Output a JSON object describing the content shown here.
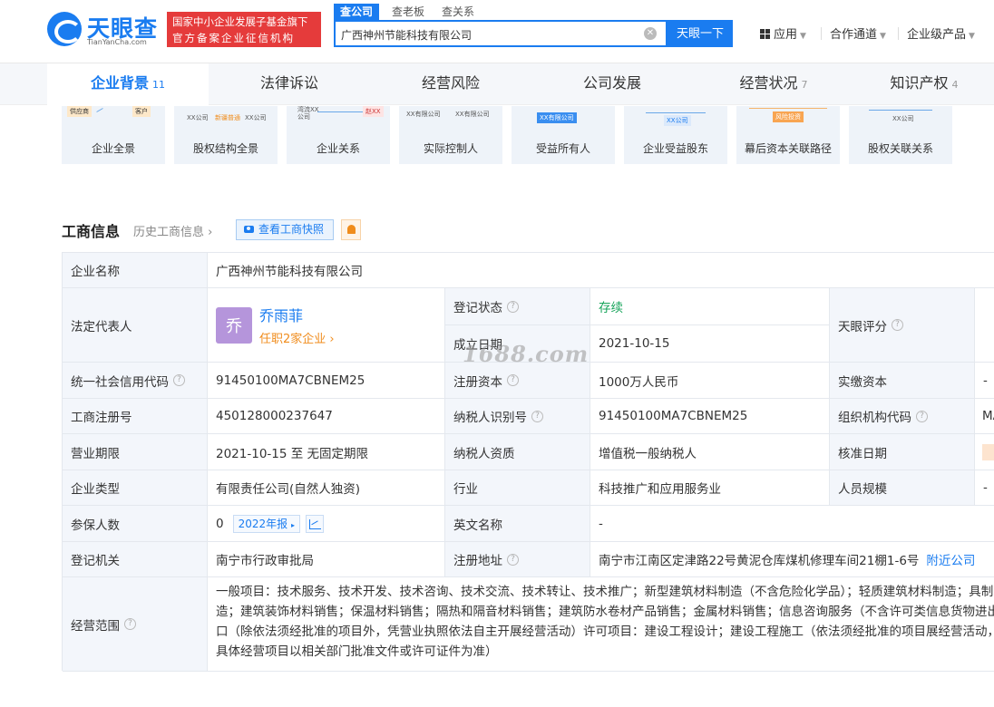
{
  "header": {
    "logo_name": "天眼查",
    "logo_url": "TianYanCha.com",
    "slogan_line1": "国家中小企业发展子基金旗下",
    "slogan_line2": "官方备案企业征信机构",
    "search_tabs": [
      "查公司",
      "查老板",
      "查关系"
    ],
    "search_value": "广西神州节能科技有限公司",
    "search_button": "天眼一下",
    "nav": [
      "应用",
      "合作通道",
      "企业级产品"
    ]
  },
  "main_tabs": [
    {
      "label": "企业背景",
      "count": "11"
    },
    {
      "label": "法律诉讼",
      "count": ""
    },
    {
      "label": "经营风险",
      "count": ""
    },
    {
      "label": "公司发展",
      "count": ""
    },
    {
      "label": "经营状况",
      "count": "7"
    },
    {
      "label": "知识产权",
      "count": "4"
    }
  ],
  "cards": [
    {
      "label": "企业全景",
      "thumb": [
        "供应商",
        "客户"
      ]
    },
    {
      "label": "股权结构全景",
      "thumb": [
        "XX公司",
        "新疆普通",
        "XX公司"
      ]
    },
    {
      "label": "企业关系",
      "thumb": [
        "湾流XX",
        "公司",
        "赵XX"
      ]
    },
    {
      "label": "实际控制人",
      "thumb": [
        "XX有限公司",
        "XX有限公司"
      ]
    },
    {
      "label": "受益所有人",
      "thumb": [
        "XX有限公司"
      ]
    },
    {
      "label": "企业受益股东",
      "thumb": [
        "XX公司"
      ]
    },
    {
      "label": "幕后资本关联路径",
      "thumb": [
        "风险投资"
      ]
    },
    {
      "label": "股权关联关系",
      "thumb": [
        "XX公司"
      ]
    }
  ],
  "section": {
    "title": "工商信息",
    "history": "历史工商信息",
    "snapshot_button": "查看工商快照"
  },
  "info": {
    "company_name_label": "企业名称",
    "company_name": "广西神州节能科技有限公司",
    "legal_rep_label": "法定代表人",
    "legal_rep_avatar": "乔",
    "legal_rep_name": "乔雨菲",
    "legal_rep_sub": "任职2家企业",
    "reg_status_label": "登记状态",
    "reg_status": "存续",
    "est_date_label": "成立日期",
    "est_date": "2021-10-15",
    "score_label": "天眼评分",
    "credit_code_label": "统一社会信用代码",
    "credit_code": "91450100MA7CBNEM25",
    "reg_capital_label": "注册资本",
    "reg_capital": "1000万人民币",
    "paid_capital_label": "实缴资本",
    "paid_capital": "-",
    "reg_no_label": "工商注册号",
    "reg_no": "450128000237647",
    "taxpayer_id_label": "纳税人识别号",
    "taxpayer_id": "91450100MA7CBNEM25",
    "org_code_label": "组织机构代码",
    "org_code": "MA",
    "term_label": "营业期限",
    "term": "2021-10-15 至 无固定期限",
    "taxpayer_type_label": "纳税人资质",
    "taxpayer_type": "增值税一般纳税人",
    "approval_date_label": "核准日期",
    "company_type_label": "企业类型",
    "company_type": "有限责任公司(自然人独资)",
    "industry_label": "行业",
    "industry": "科技推广和应用服务业",
    "staff_size_label": "人员规模",
    "staff_size": "-",
    "insured_label": "参保人数",
    "insured": "0",
    "insured_year": "2022年报",
    "english_name_label": "英文名称",
    "english_name": "-",
    "authority_label": "登记机关",
    "authority": "南宁市行政审批局",
    "address_label": "注册地址",
    "address": "南宁市江南区定津路22号黄泥仓库煤机修理车间21棚1-6号",
    "nearby_link": "附近公司",
    "scope_label": "经营范围",
    "scope": "一般项目：技术服务、技术开发、技术咨询、技术交流、技术转让、技术推广；新型建筑材料制造（不含危险化学品）；轻质建筑材料制造；具制造；建筑装饰材料销售；保温材料销售；隔热和隔音材料销售；建筑防水卷材产品销售；金属材料销售；信息咨询服务（不含许可类信息货物进出口（除依法须经批准的项目外，凭营业执照依法自主开展经营活动）许可项目：建设工程设计；建设工程施工（依法须经批准的项目展经营活动，具体经营项目以相关部门批准文件或许可证件为准）"
  },
  "watermark": "1688.com",
  "colors": {
    "brand": "#1a7cf0",
    "slogan_bg": "#e53b3b",
    "status_green": "#19a55c",
    "accent_orange": "#f08c1c"
  }
}
